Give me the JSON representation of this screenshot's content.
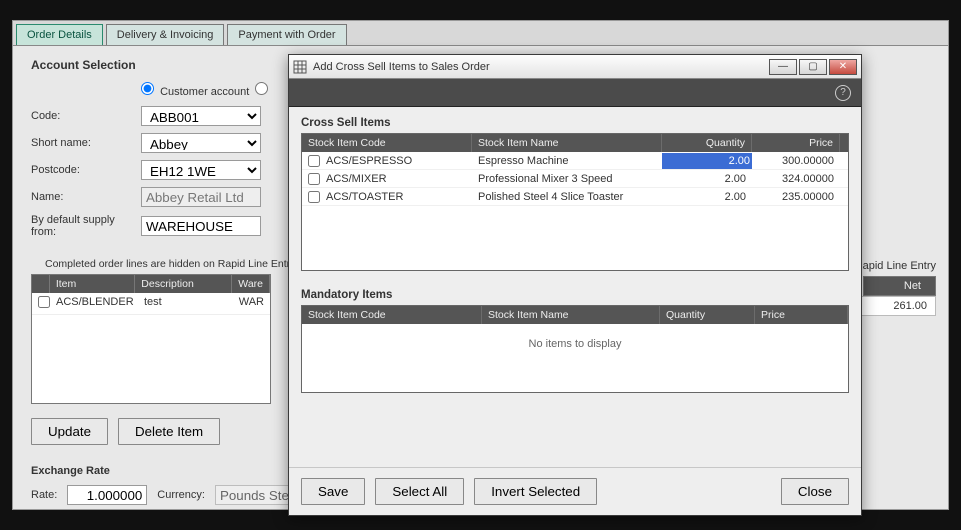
{
  "tabs": {
    "order_details": "Order Details",
    "delivery": "Delivery & Invoicing",
    "payment": "Payment with Order"
  },
  "section": {
    "account_selection": "Account Selection",
    "exchange_rate": "Exchange Rate"
  },
  "account": {
    "radio_customer": "Customer account",
    "labels": {
      "code": "Code:",
      "short_name": "Short name:",
      "postcode": "Postcode:",
      "name": "Name:",
      "default_supply": "By default supply from:"
    },
    "values": {
      "code": "ABB001",
      "short_name": "Abbey",
      "postcode": "EH12 1WE",
      "name": "Abbey Retail Ltd",
      "default_supply": "WAREHOUSE"
    }
  },
  "lines": {
    "hint": "Completed order lines are hidden on Rapid Line Entry.",
    "headers": {
      "item": "Item",
      "description": "Description",
      "warehouse": "Ware"
    },
    "row": {
      "item": "ACS/BLENDER",
      "description": "test",
      "warehouse": "WAR"
    }
  },
  "buttons": {
    "update": "Update",
    "delete_item": "Delete Item"
  },
  "rates": {
    "rate_label": "Rate:",
    "rate_value": "1.000000",
    "currency_label": "Currency:",
    "currency_value": "Pounds Sterl"
  },
  "right": {
    "rapid_label": "Rapid Line Entry",
    "net_header": "Net",
    "net_value": "261.00"
  },
  "modal": {
    "title": "Add Cross Sell Items to Sales Order",
    "cross_sell_title": "Cross Sell Items",
    "mandatory_title": "Mandatory Items",
    "empty_mandatory": "No items to display",
    "headers": {
      "code": "Stock Item Code",
      "name": "Stock Item Name",
      "qty": "Quantity",
      "price": "Price"
    },
    "items": [
      {
        "code": "ACS/ESPRESSO",
        "name": "Espresso Machine",
        "qty": "2.00",
        "price": "300.00000",
        "selected": true
      },
      {
        "code": "ACS/MIXER",
        "name": "Professional Mixer 3 Speed",
        "qty": "2.00",
        "price": "324.00000",
        "selected": false
      },
      {
        "code": "ACS/TOASTER",
        "name": "Polished Steel 4 Slice Toaster",
        "qty": "2.00",
        "price": "235.00000",
        "selected": false
      }
    ],
    "footer": {
      "save": "Save",
      "select_all": "Select All",
      "invert": "Invert Selected",
      "close": "Close"
    }
  }
}
